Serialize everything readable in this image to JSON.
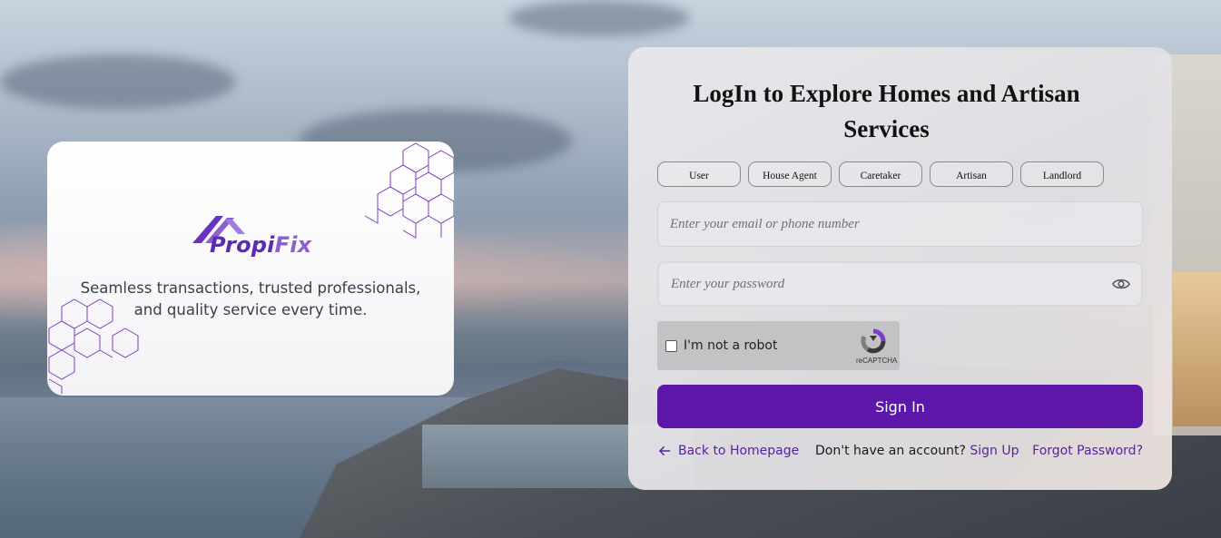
{
  "brand": {
    "name_part1": "Propi",
    "name_part2": "Fix",
    "tagline_line1": "Seamless transactions, trusted professionals,",
    "tagline_line2": "and quality service every time."
  },
  "login": {
    "title_line1": "LogIn to Explore Homes and Artisan",
    "title_line2": "Services",
    "roles": [
      "User",
      "House Agent",
      "Caretaker",
      "Artisan",
      "Landlord"
    ],
    "email_placeholder": "Enter your email or phone number",
    "email_value": "",
    "password_placeholder": "Enter your password",
    "password_value": "",
    "captcha_label": "I'm not a robot",
    "captcha_brand": "reCAPTCHA",
    "signin_label": "Sign In",
    "back_link": "Back to Homepage",
    "no_account_text": "Don't have an account?",
    "signup_link": "Sign Up",
    "forgot_link": "Forgot Password?"
  },
  "icons": {
    "eye": "eye-icon",
    "arrow_left": "arrow-left-icon",
    "recaptcha": "recaptcha-icon",
    "logo": "house-roof-logo"
  },
  "colors": {
    "primary": "#5c17a8",
    "brand_dark": "#5b2bb3",
    "brand_light": "#8d5fd1",
    "link": "#5a1ea3"
  }
}
